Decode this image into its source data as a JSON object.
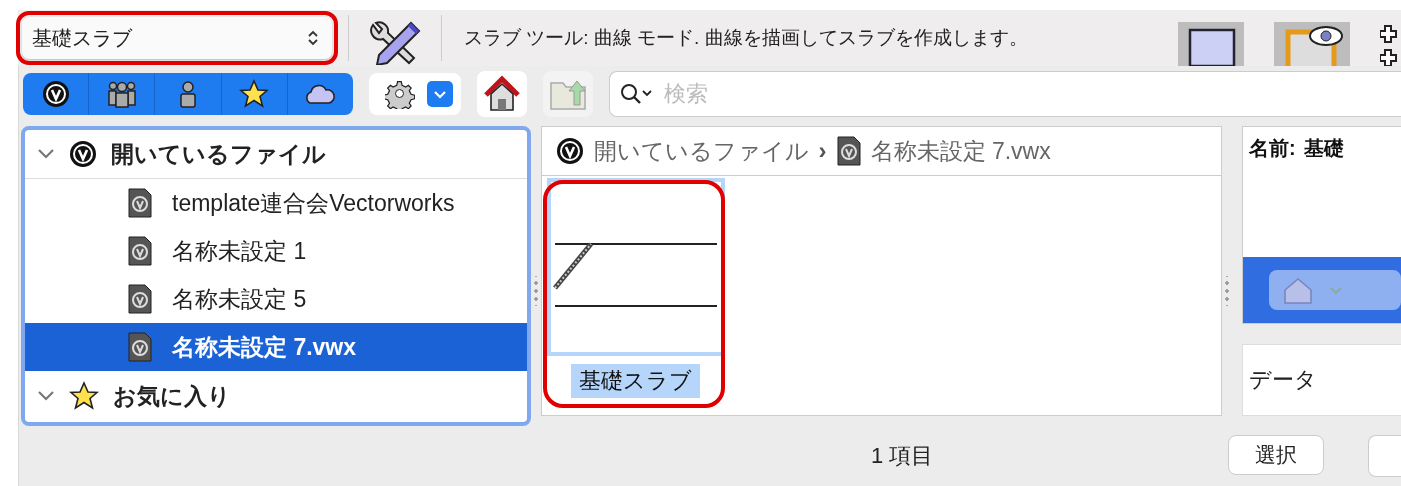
{
  "tool_bar": {
    "object_popup": {
      "value": "基礎スラブ",
      "highlighted": true
    },
    "help_text": "スラブ ツール: 曲線 モード. 曲線を描画してスラブを作成します。"
  },
  "search": {
    "placeholder": "検索"
  },
  "tree": [
    {
      "label": "開いているファイル",
      "kind": "open_files",
      "expanded": true,
      "children": [
        {
          "label": "template連合会Vectorworks",
          "selected": false
        },
        {
          "label": "名称未設定 1",
          "selected": false
        },
        {
          "label": "名称未設定 5",
          "selected": false
        },
        {
          "label": "名称未設定 7.vwx",
          "selected": true
        }
      ]
    },
    {
      "label": "お気に入り",
      "kind": "favorites",
      "expanded": true
    }
  ],
  "breadcrumb": {
    "separator": "›",
    "items": [
      {
        "label": "開いているファイル",
        "kind": "open_files"
      },
      {
        "label": "名称未設定 7.vwx",
        "kind": "file"
      }
    ]
  },
  "items": [
    {
      "label": "基礎スラブ",
      "selected": true,
      "highlighted": true
    }
  ],
  "info": {
    "name_label": "名前:",
    "name_value": "基礎",
    "data_label": "データ"
  },
  "status": {
    "count": "1 項目",
    "buttons": [
      "選択"
    ]
  }
}
